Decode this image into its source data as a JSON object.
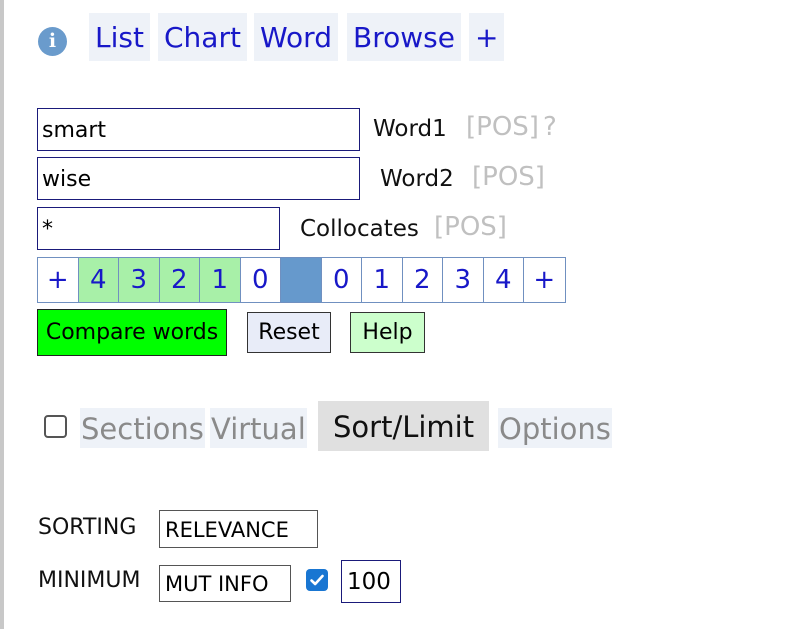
{
  "nav": {
    "tabs": [
      {
        "label": "List"
      },
      {
        "label": "Chart"
      },
      {
        "label": "Word"
      },
      {
        "label": "Browse"
      },
      {
        "label": "+"
      }
    ],
    "info_icon": "info-icon"
  },
  "search": {
    "word1": {
      "value": "smart",
      "label": "Word1",
      "pos": "[POS]",
      "hint": "?"
    },
    "word2": {
      "value": "wise",
      "label": "Word2",
      "pos": "[POS]"
    },
    "collocates": {
      "value": "*",
      "label": "Collocates",
      "pos": "[POS]"
    }
  },
  "span": {
    "left": [
      "+",
      "4",
      "3",
      "2",
      "1",
      "0"
    ],
    "right": [
      "0",
      "1",
      "2",
      "3",
      "4",
      "+"
    ],
    "selected_left": [
      "4",
      "3",
      "2",
      "1"
    ]
  },
  "buttons": {
    "compare": "Compare words",
    "reset": "Reset",
    "help": "Help"
  },
  "subtabs": {
    "sections": {
      "label": "Sections",
      "checked": false
    },
    "virtual": {
      "label": "Virtual"
    },
    "sort_limit": {
      "label": "Sort/Limit",
      "active": true
    },
    "options": {
      "label": "Options"
    }
  },
  "sorting": {
    "label": "SORTING",
    "value": "RELEVANCE"
  },
  "minimum": {
    "label": "MINIMUM",
    "measure": "MUT INFO",
    "enabled": true,
    "value": "100"
  },
  "colors": {
    "link": "#1818c8",
    "compare_button": "#00ff00",
    "span_selected": "#a8f0a8",
    "span_node": "#6699cc",
    "checkbox_checked": "#1976d2"
  }
}
